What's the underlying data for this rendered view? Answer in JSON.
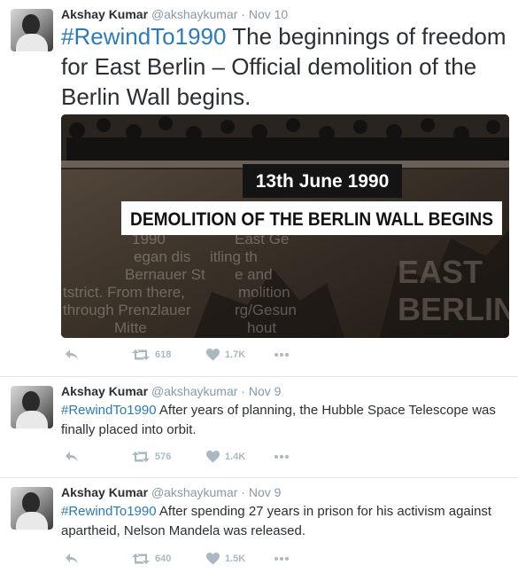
{
  "tweets": [
    {
      "name": "Akshay Kumar",
      "handle": "@akshaykumar",
      "date": "· Nov 10",
      "hashtag": "#RewindTo1990",
      "text": " The beginnings of freedom for East Berlin – Official demolition of the Berlin Wall begins.",
      "image": {
        "date_caption": "13th June 1990",
        "headline": "DEMOLITION OF THE BERLIN WALL BEGINS",
        "overlay_text": [
          "1990",
          "East Ge",
          "egan dis",
          "itling th",
          "Bernauer St",
          "e and",
          "tstrict. From there,",
          "molition",
          "through Prenzlauer",
          "rg/Gesun",
          "Mitte",
          "hout"
        ],
        "overlay_big": [
          "EAST",
          "BERLIN"
        ]
      },
      "retweets": "618",
      "likes": "1.7K"
    },
    {
      "name": "Akshay Kumar",
      "handle": "@akshaykumar",
      "date": "· Nov 9",
      "hashtag": "#RewindTo1990",
      "text": " After years of planning, the Hubble Space Telescope was finally placed into orbit.",
      "retweets": "576",
      "likes": "1.4K"
    },
    {
      "name": "Akshay Kumar",
      "handle": "@akshaykumar",
      "date": "· Nov 9",
      "hashtag": "#RewindTo1990",
      "text": " After spending 27 years in prison for his activism against apartheid, Nelson Mandela was released.",
      "retweets": "640",
      "likes": "1.5K"
    }
  ],
  "colors": {
    "hashtag": "#2b7bb9",
    "icon": "#aab8c2",
    "separator": "#e1e8ed"
  },
  "icons": {
    "reply": "reply-icon",
    "retweet": "retweet-icon",
    "like": "heart-icon",
    "more": "more-icon"
  }
}
